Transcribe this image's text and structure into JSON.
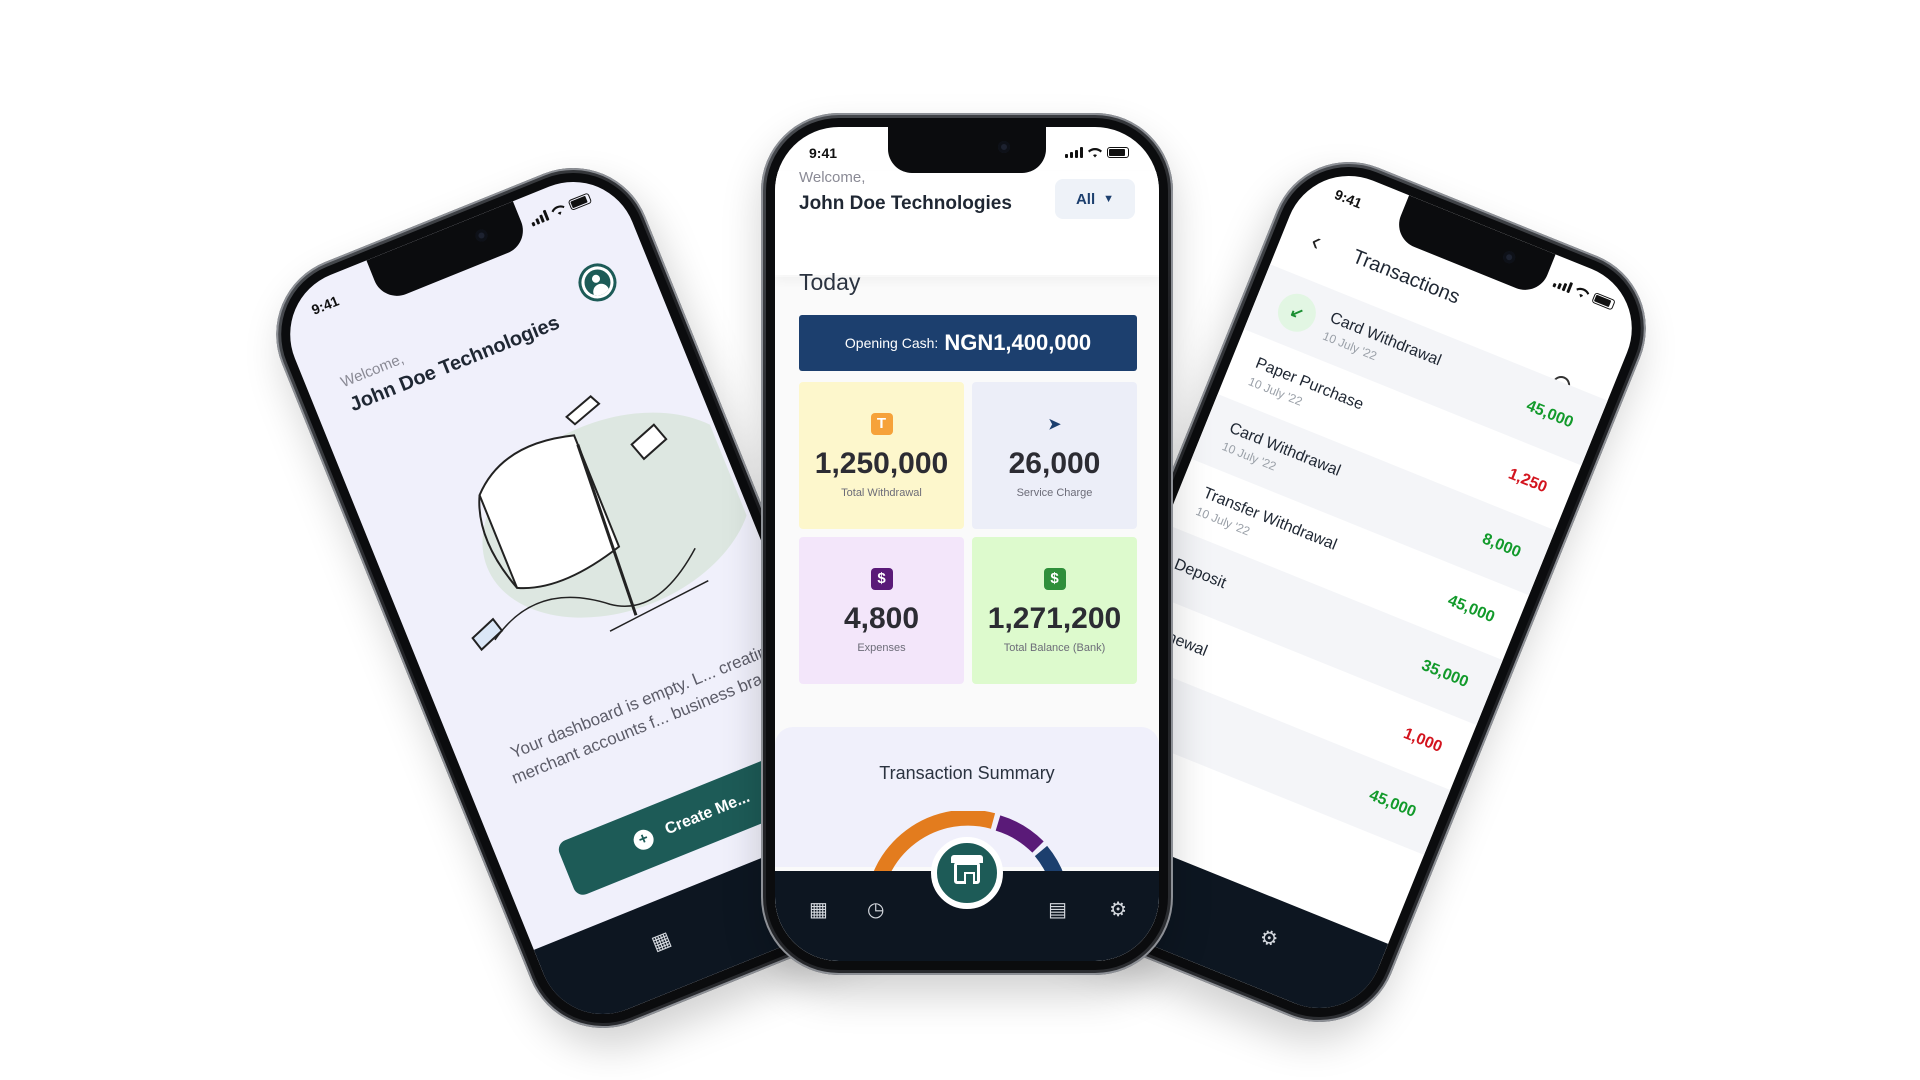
{
  "status": {
    "time": "9:41"
  },
  "left": {
    "welcome": "Welcome,",
    "company": "John Doe Technologies",
    "empty_text": "Your dashboard is empty. L... creating merchant accounts f... business brand...",
    "create_button": "Create Me..."
  },
  "center": {
    "welcome": "Welcome,",
    "company": "John Doe Technologies",
    "filter": "All",
    "today": "Today",
    "opening_label": "Opening Cash:",
    "opening_value": "NGN1,400,000",
    "cards": [
      {
        "value": "1,250,000",
        "label": "Total Withdrawal"
      },
      {
        "value": "26,000",
        "label": "Service Charge"
      },
      {
        "value": "4,800",
        "label": "Expenses"
      },
      {
        "value": "1,271,200",
        "label": "Total Balance (Bank)"
      }
    ],
    "summary_title": "Transaction Summary"
  },
  "right": {
    "title": "Transactions",
    "items": [
      {
        "name": "Card Withdrawal",
        "date": "10 July '22",
        "amount": "45,000",
        "type": "credit"
      },
      {
        "name": "Paper Purchase",
        "date": "10 July '22",
        "amount": "1,250",
        "type": "debit"
      },
      {
        "name": "Card Withdrawal",
        "date": "10 July '22",
        "amount": "8,000",
        "type": "credit"
      },
      {
        "name": "Transfer Withdrawal",
        "date": "10 July '22",
        "amount": "45,000",
        "type": "credit"
      },
      {
        "name": "Deposit",
        "date": "",
        "amount": "35,000",
        "type": "credit"
      },
      {
        "name": "Renewal",
        "date": "",
        "amount": "1,000",
        "type": "debit"
      },
      {
        "name": "",
        "date": "",
        "amount": "45,000",
        "type": "credit"
      }
    ]
  },
  "colors": {
    "brand_green": "#1d5b57",
    "navy": "#1c3f6e",
    "nav_dark": "#0d1621",
    "credit": "#129a2b",
    "debit": "#d3141e"
  }
}
